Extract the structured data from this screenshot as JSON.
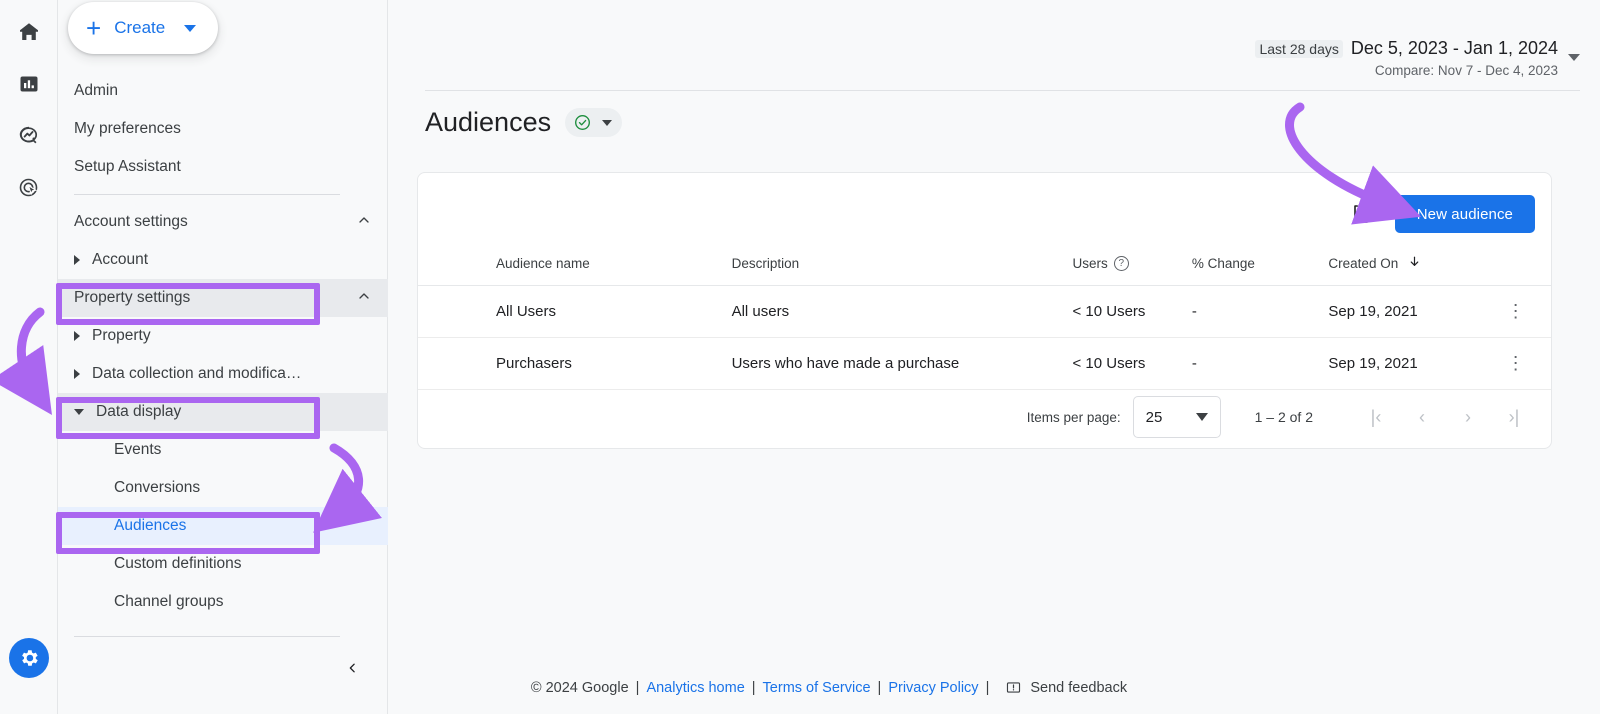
{
  "accent": {
    "blue": "#1a73e8",
    "purple_highlight": "#aa66f0",
    "green": "#1e8e3e",
    "active_bg": "#e8f0fe"
  },
  "rail": {
    "items": [
      {
        "name": "home-icon",
        "label": "Home"
      },
      {
        "name": "reports-icon",
        "label": "Reports"
      },
      {
        "name": "explore-icon",
        "label": "Explore"
      },
      {
        "name": "advertising-icon",
        "label": "Advertising"
      }
    ],
    "gear": {
      "name": "admin-gear-icon",
      "label": "Admin"
    }
  },
  "sidebar": {
    "create_button": {
      "label": "Create",
      "plus": "+"
    },
    "items": [
      {
        "label": "Admin",
        "level": 1,
        "type": "link"
      },
      {
        "label": "My preferences",
        "level": 1,
        "type": "link"
      },
      {
        "label": "Setup Assistant",
        "level": 1,
        "type": "link"
      },
      {
        "label": "Account settings",
        "level": 1,
        "type": "section",
        "expanded": true
      },
      {
        "label": "Account",
        "level": 2,
        "type": "tree",
        "expanded": false
      },
      {
        "label": "Property settings",
        "level": 1,
        "type": "section",
        "expanded": true,
        "highlighted": true
      },
      {
        "label": "Property",
        "level": 2,
        "type": "tree",
        "expanded": false
      },
      {
        "label": "Data collection and modifica…",
        "level": 2,
        "type": "tree",
        "expanded": false
      },
      {
        "label": "Data display",
        "level": 2,
        "type": "tree",
        "expanded": true,
        "highlighted": true
      },
      {
        "label": "Events",
        "level": 3,
        "type": "link"
      },
      {
        "label": "Conversions",
        "level": 3,
        "type": "link"
      },
      {
        "label": "Audiences",
        "level": 3,
        "type": "link",
        "active": true,
        "highlighted": true
      },
      {
        "label": "Custom definitions",
        "level": 3,
        "type": "link"
      },
      {
        "label": "Channel groups",
        "level": 3,
        "type": "link"
      }
    ],
    "collapse": {
      "name": "collapse-sidebar-button",
      "glyph": "‹"
    }
  },
  "date_range": {
    "preset": "Last 28 days",
    "range": "Dec 5, 2023 - Jan 1, 2024",
    "compare": "Compare: Nov 7 - Dec 4, 2023"
  },
  "page": {
    "title": "Audiences",
    "status_icon": "check-circle-icon"
  },
  "card": {
    "download_label": "Download",
    "new_audience_label": "New audience",
    "columns": [
      "Audience name",
      "Description",
      "Users",
      "% Change",
      "Created On"
    ],
    "rows": [
      {
        "name": "All Users",
        "description": "All users",
        "users": "< 10 Users",
        "change": "-",
        "created_on": "Sep 19, 2021"
      },
      {
        "name": "Purchasers",
        "description": "Users who have made a purchase",
        "users": "< 10 Users",
        "change": "-",
        "created_on": "Sep 19, 2021"
      }
    ],
    "pagination": {
      "items_per_page_label": "Items per page:",
      "items_per_page_value": "25",
      "range_label": "1 – 2 of 2",
      "first_glyph": "|‹",
      "prev_glyph": "‹",
      "next_glyph": "›",
      "last_glyph": "›|"
    }
  },
  "footer": {
    "copyright": "© 2024 Google",
    "links": [
      "Analytics home",
      "Terms of Service",
      "Privacy Policy"
    ],
    "feedback": "Send feedback",
    "separator": "|"
  }
}
